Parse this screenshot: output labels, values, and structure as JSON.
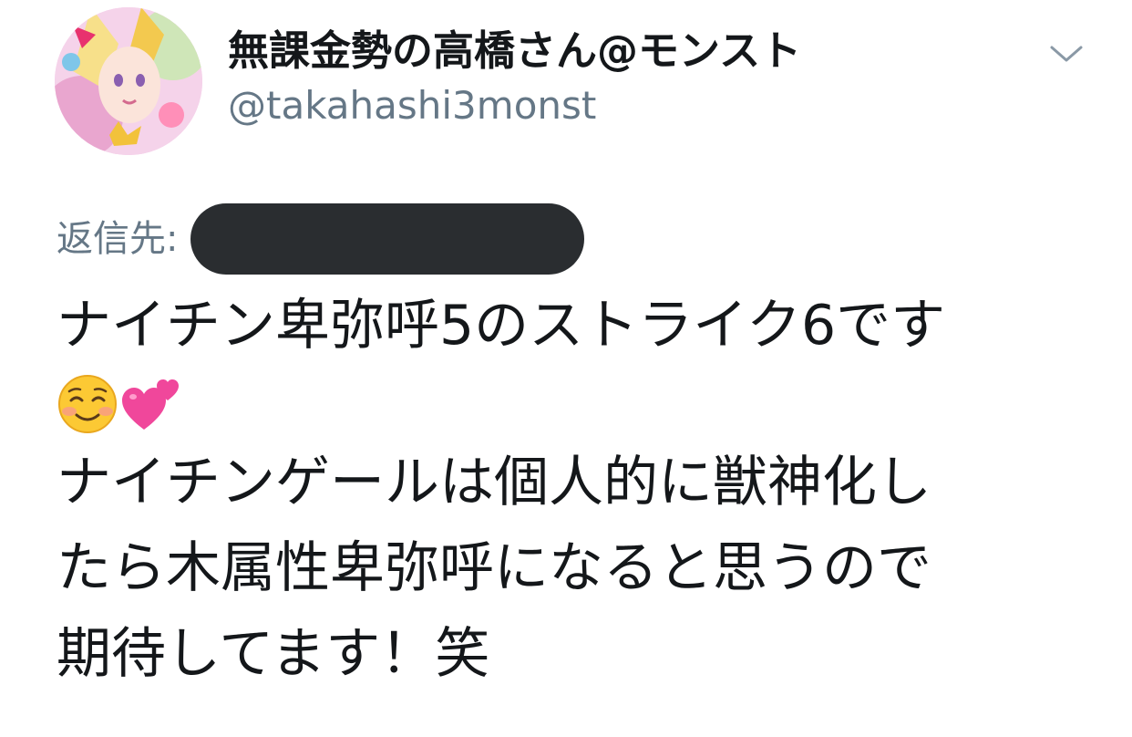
{
  "author": {
    "display_name": "無課金勢の高橋さん@モンスト",
    "handle": "@takahashi3monst"
  },
  "reply": {
    "label": "返信先:"
  },
  "tweet": {
    "line1": "ナイチン卑弥呼5のストライク6です",
    "emojis": [
      "smiling-face-emoji",
      "two-hearts-emoji"
    ],
    "line2": "ナイチンゲールは個人的に獣神化し",
    "line3": "たら木属性卑弥呼になると思うので",
    "line4": "期待してます！笑"
  },
  "colors": {
    "text": "#14171a",
    "secondary": "#657786",
    "redaction": "#2a2d30",
    "heart": "#f0479b"
  },
  "icons": {
    "menu": "chevron-down-icon"
  }
}
